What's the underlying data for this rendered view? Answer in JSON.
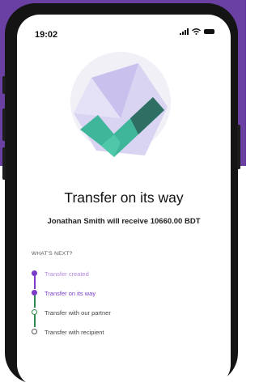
{
  "status_bar": {
    "time": "19:02"
  },
  "transfer": {
    "title": "Transfer on its way",
    "message": "Jonathan Smith will receive 10660.00 BDT"
  },
  "next_steps": {
    "label": "WHAT'S NEXT?",
    "steps": [
      {
        "label": "Transfer created",
        "state": "done"
      },
      {
        "label": "Transfer on its way",
        "state": "current"
      },
      {
        "label": "Transfer with our partner",
        "state": "pending"
      },
      {
        "label": "Transfer with recipient",
        "state": "pending"
      }
    ]
  },
  "colors": {
    "background_purple": "#6a40a3",
    "accent_purple": "#7a3cc8",
    "check_green": "#3fb59a",
    "check_dark": "#2f6e63",
    "hero_lavender": "#cfc8ef",
    "pending_green": "#2f8a4f"
  },
  "icons": {
    "signal": "signal-icon",
    "wifi": "wifi-icon",
    "battery": "battery-icon",
    "hero": "checkmark-illustration-icon"
  }
}
